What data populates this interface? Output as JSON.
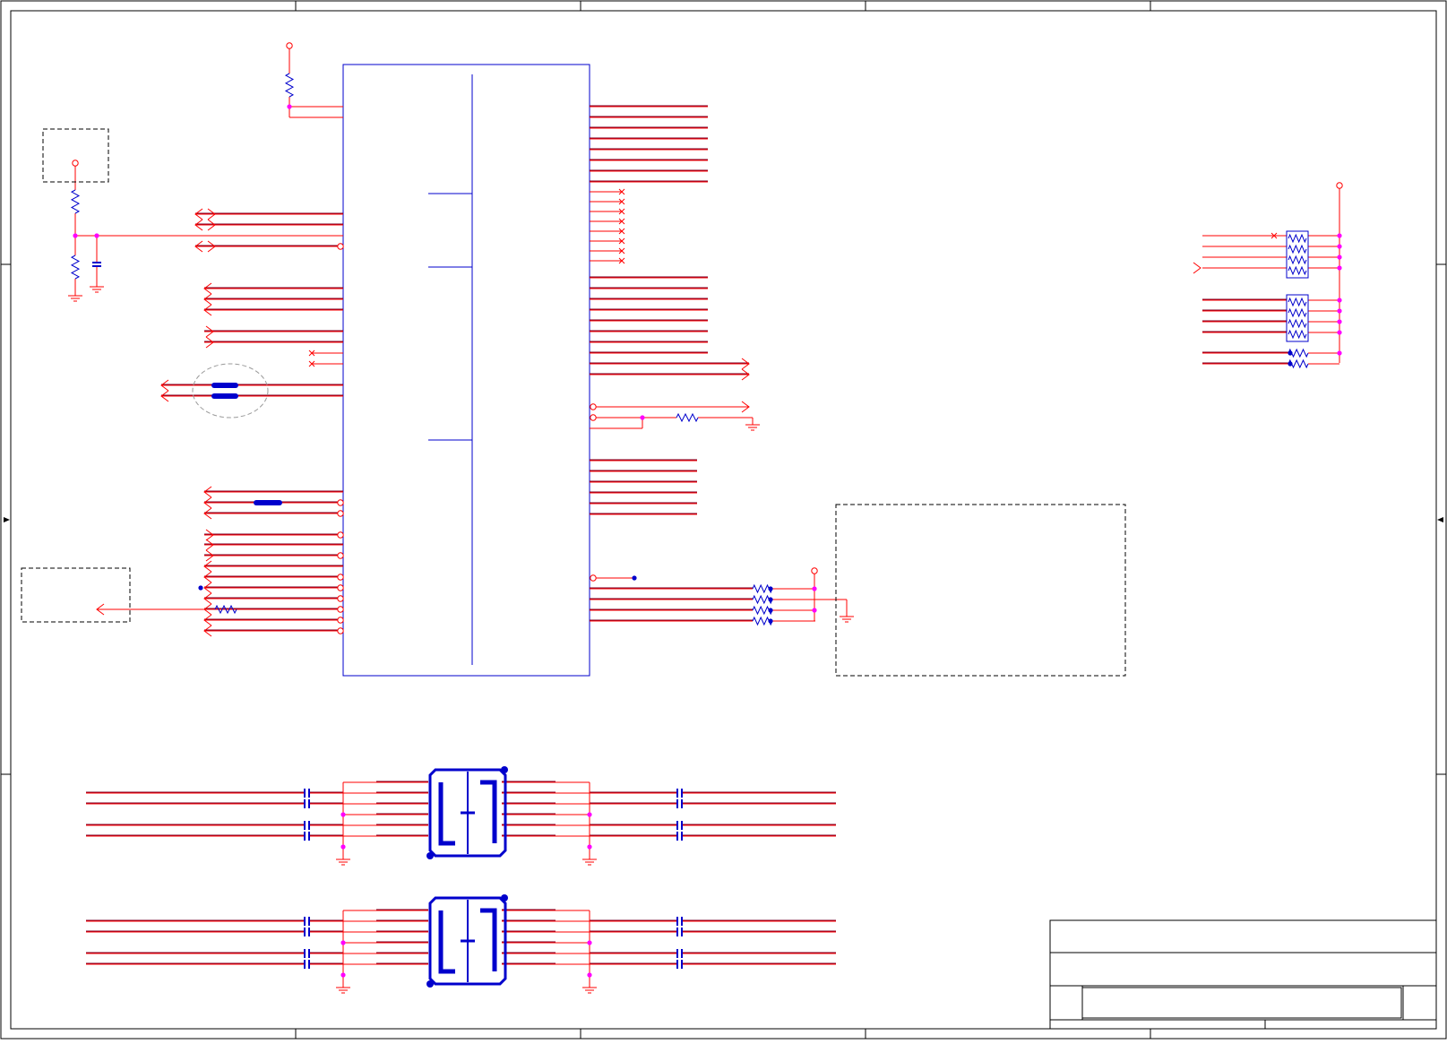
{
  "colors": {
    "wire": "#ff0000",
    "bus": "#7a0026",
    "component": "#0000cc",
    "junction": "#ff00ff",
    "frame": "#000000",
    "dashed_box": "#000000",
    "callout": "#999999"
  },
  "icons": {
    "ground": "ground-icon",
    "power": "power-pin-icon",
    "resistor": "resistor-icon",
    "capacitor": "capacitor-icon",
    "off_page_connector": "off-page-connector-icon",
    "no_connect": "no-connect-icon",
    "transformer": "ethernet-transformer-icon",
    "ferrite": "ferrite-bead-icon"
  },
  "sheet": {
    "frame_zone_labels": [],
    "title_block": {
      "title": "",
      "document_number": "",
      "revision": "",
      "sheet": "",
      "date": ""
    }
  },
  "schematic": {
    "main_ic": {
      "reference": "",
      "part": ""
    },
    "left_pin_groups": 6,
    "right_pin_groups": 6,
    "resistor_network_count": 2,
    "transformer_count": 2,
    "note_box_text": ""
  }
}
